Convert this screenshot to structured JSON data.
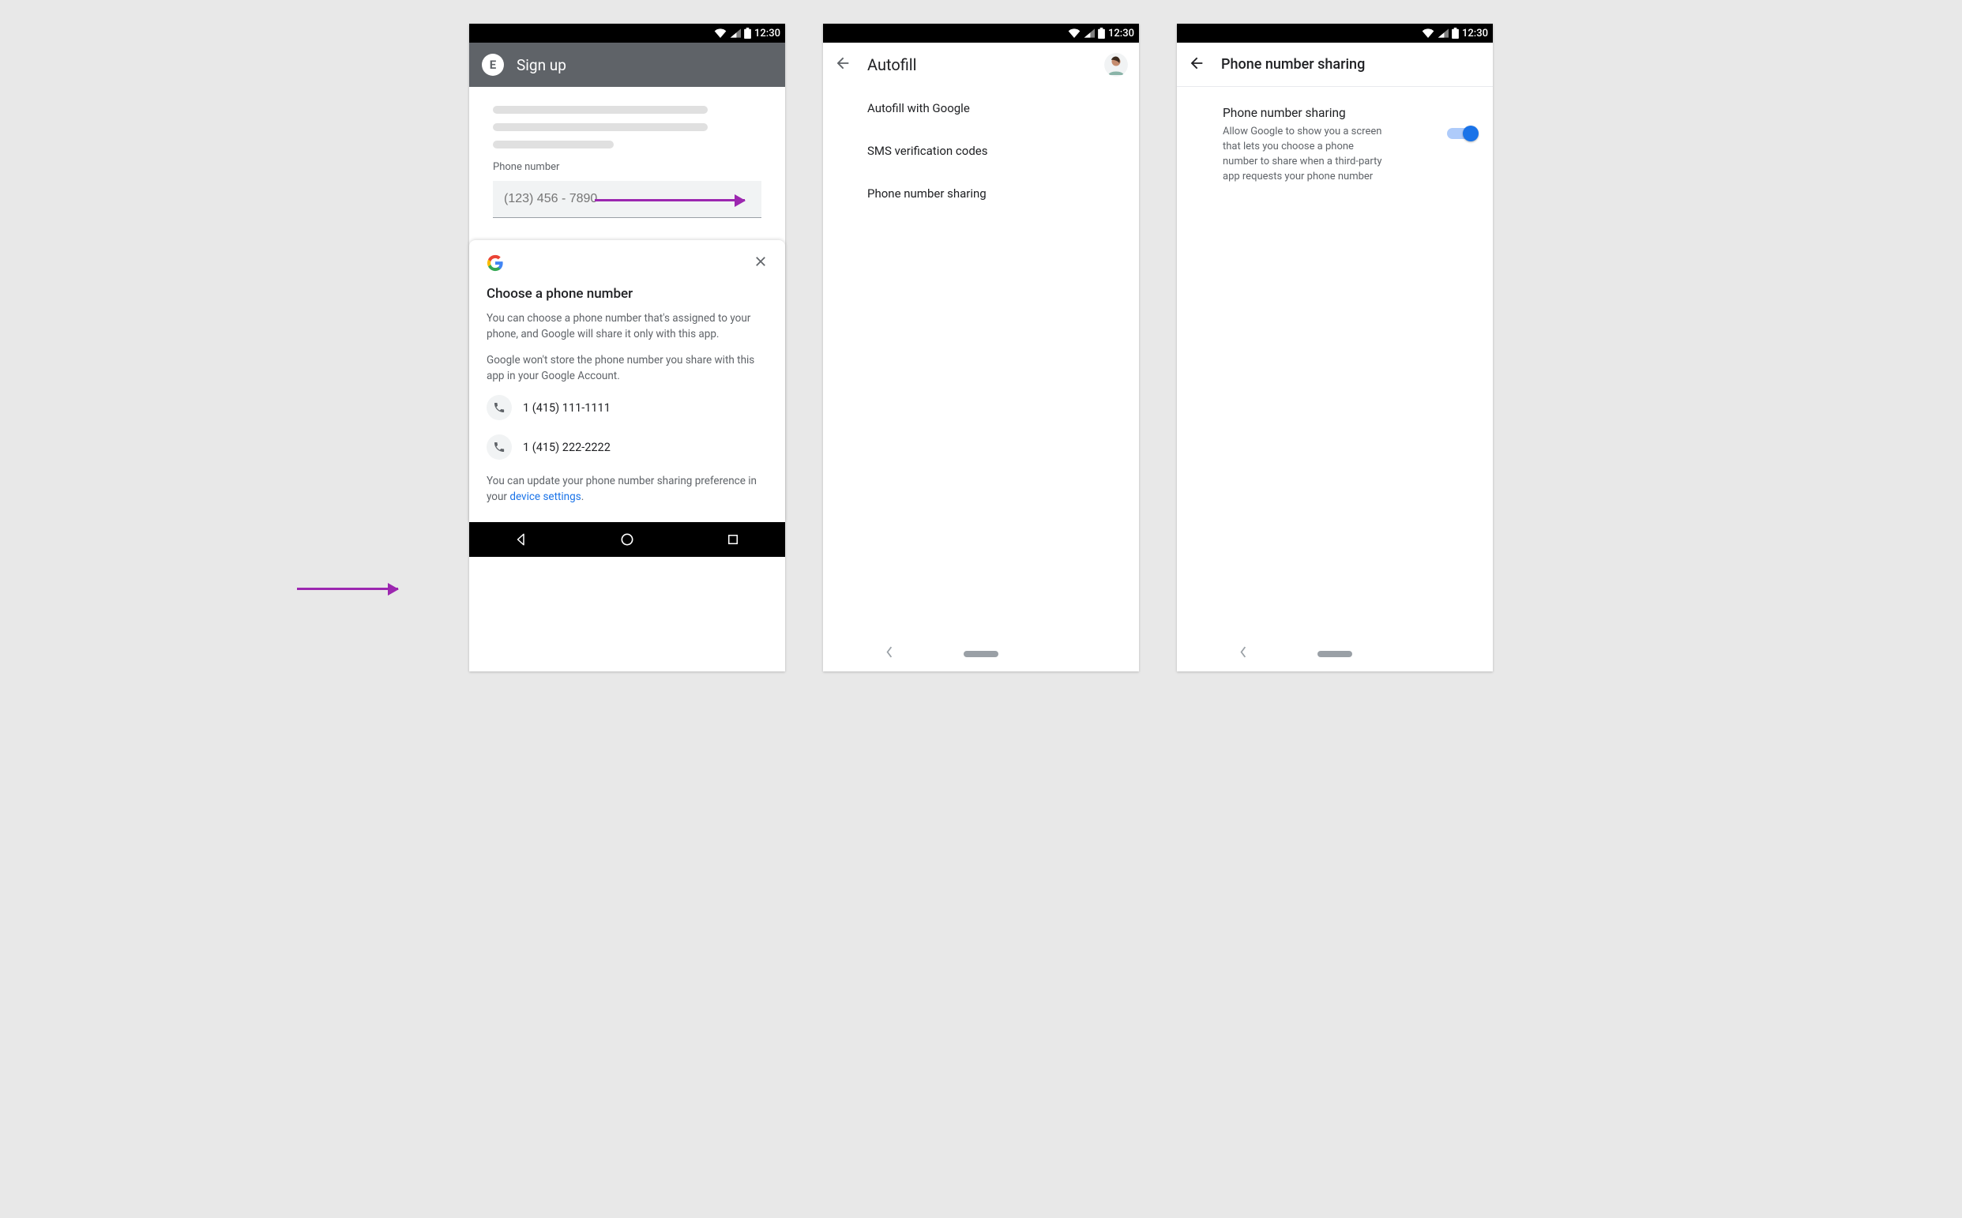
{
  "statusbar": {
    "time": "12:30"
  },
  "screen1": {
    "app_letter": "E",
    "app_title": "Sign up",
    "field_label": "Phone number",
    "field_placeholder": "(123) 456 - 7890",
    "sheet": {
      "title": "Choose a phone number",
      "p1": "You can choose a phone number that's assigned to your phone, and Google will share it only with this app.",
      "p2": "Google won't store the phone number you share with this app in your Google Account.",
      "options": [
        {
          "number": "1 (415) 111-1111"
        },
        {
          "number": "1 (415) 222-2222"
        }
      ],
      "foot_pre": "You can update your phone number sharing preference in your ",
      "foot_link": "device settings",
      "foot_post": "."
    }
  },
  "screen2": {
    "title": "Autofill",
    "items": [
      {
        "label": "Autofill with Google"
      },
      {
        "label": "SMS verification codes"
      },
      {
        "label": "Phone number sharing"
      }
    ]
  },
  "screen3": {
    "title": "Phone number sharing",
    "setting_title": "Phone number sharing",
    "setting_desc": "Allow Google to show you a screen that lets you choose a phone number to share when a third-party app requests your phone number",
    "toggle_on": true
  }
}
